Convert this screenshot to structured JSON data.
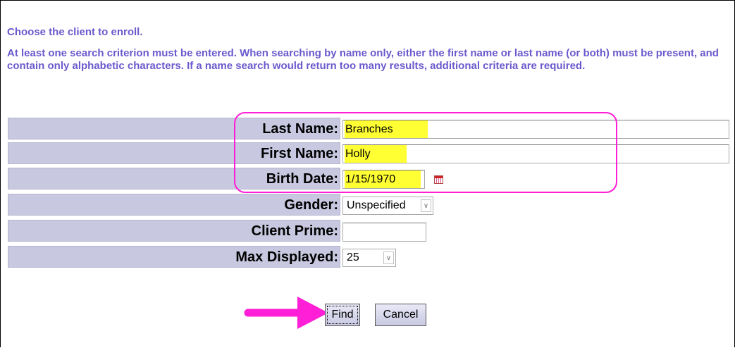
{
  "instructions": {
    "heading": "Choose the client to enroll.",
    "body": "At least one search criterion must be entered. When searching by name only, either the first name or last name (or both) must be present, and contain only alphabetic characters. If a name search would return too many results, additional criteria are required."
  },
  "form": {
    "last_name": {
      "label": "Last Name:",
      "value": "Branches"
    },
    "first_name": {
      "label": "First Name:",
      "value": "Holly"
    },
    "birth_date": {
      "label": "Birth Date:",
      "value": "1/15/1970",
      "icon": "calendar-icon"
    },
    "gender": {
      "label": "Gender:",
      "selected": "Unspecified"
    },
    "client_prime": {
      "label": "Client Prime:",
      "value": ""
    },
    "max_displayed": {
      "label": "Max Displayed:",
      "selected": "25"
    }
  },
  "buttons": {
    "find": "Find",
    "cancel": "Cancel"
  },
  "annotations": {
    "highlight_color": "#ff1fd6",
    "field_highlight_color": "#ffff33"
  }
}
